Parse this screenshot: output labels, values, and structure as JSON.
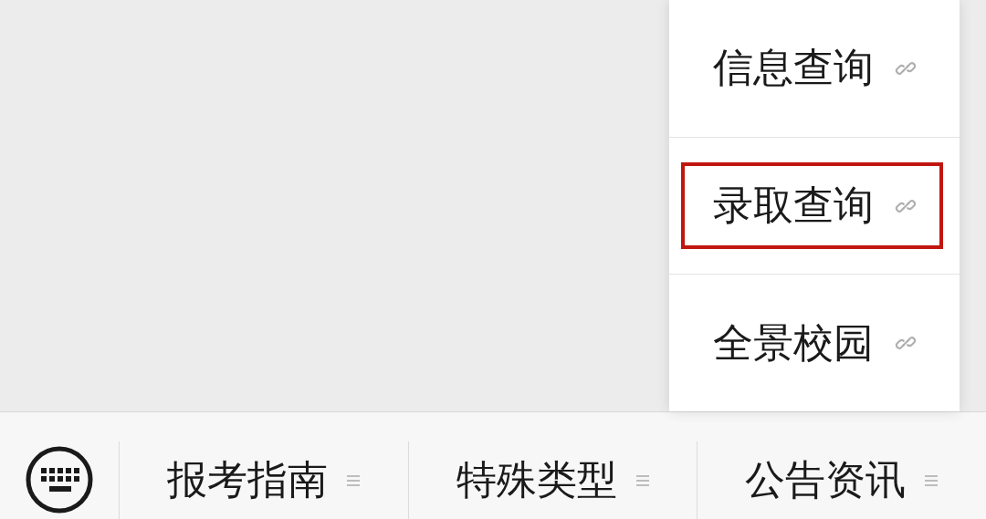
{
  "popup_menu": {
    "items": [
      {
        "label": "信息查询",
        "highlighted": false
      },
      {
        "label": "录取查询",
        "highlighted": true
      },
      {
        "label": "全景校园",
        "highlighted": false
      }
    ]
  },
  "menu_bar": {
    "tabs": [
      {
        "label": "报考指南"
      },
      {
        "label": "特殊类型"
      },
      {
        "label": "公告资讯"
      }
    ]
  }
}
